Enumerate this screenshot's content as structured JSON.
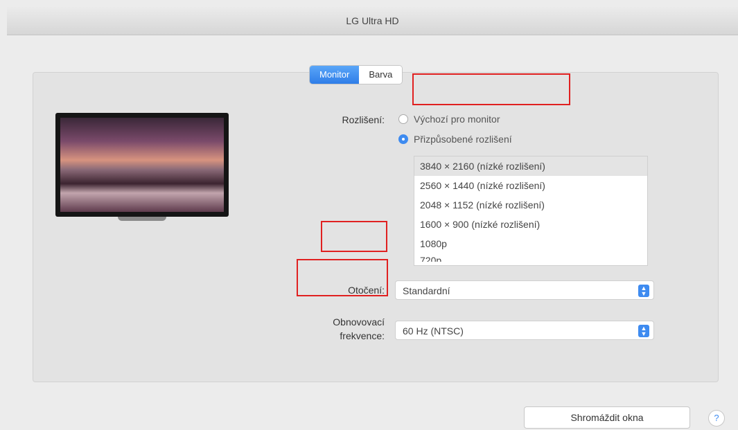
{
  "window": {
    "title": "LG Ultra HD"
  },
  "tabs": [
    {
      "label": "Monitor",
      "active": true
    },
    {
      "label": "Barva",
      "active": false
    }
  ],
  "resolution": {
    "label": "Rozlišení:",
    "options": [
      {
        "label": "Výchozí pro monitor",
        "selected": false
      },
      {
        "label": "Přizpůsobené rozlišení",
        "selected": true
      }
    ],
    "list": [
      {
        "label": "3840 × 2160 (nízké rozlišení)",
        "selected": true
      },
      {
        "label": "2560 × 1440 (nízké rozlišení)",
        "selected": false
      },
      {
        "label": "2048 × 1152 (nízké rozlišení)",
        "selected": false
      },
      {
        "label": "1600 × 900 (nízké rozlišení)",
        "selected": false
      },
      {
        "label": "1080p",
        "selected": false
      },
      {
        "label": "720p",
        "selected": false
      }
    ]
  },
  "rotation": {
    "label": "Otočení:",
    "value": "Standardní"
  },
  "refresh": {
    "label_line1": "Obnovovací",
    "label_line2": "frekvence:",
    "value": "60 Hz (NTSC)"
  },
  "footer": {
    "gather_button": "Shromáždit okna",
    "help": "?"
  },
  "colors": {
    "accent": "#3e8bf0",
    "annotation": "#e02020"
  }
}
